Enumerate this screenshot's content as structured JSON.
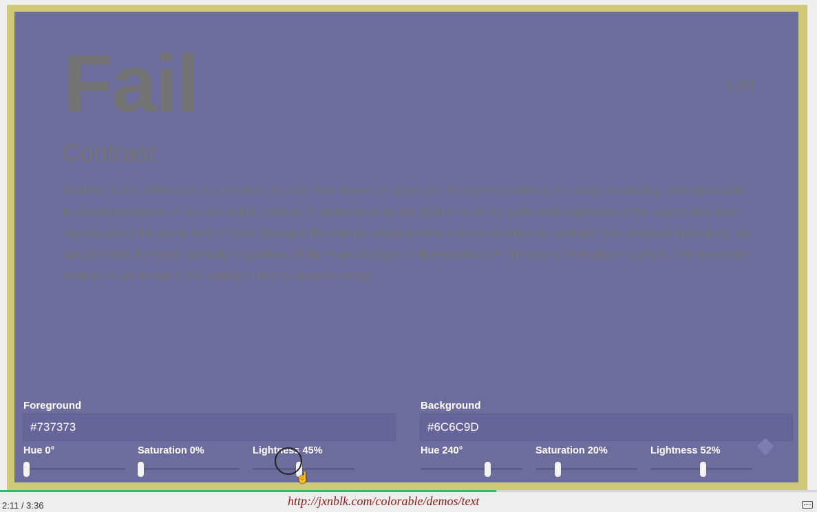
{
  "preview": {
    "status": "Fail",
    "ratio": "1.04",
    "heading": "Contrast",
    "body": "Contrast is the difference in luminance or color that makes an object (or its representation in an image or display) distinguishable. In visual perception of the real world, contrast is determined by the difference in the color and brightness of the object and other objects within the same field of view. Because the human visual system is more sensitive to contrast than absolute luminance, we can perceive the world similarly regardless of the huge changes in illumination over the day or from place to place. The maximum contrast of an image is the contrast ratio or dynamic range."
  },
  "foreground": {
    "label": "Foreground",
    "hex": "#737373",
    "hue_label": "Hue 0°",
    "saturation_label": "Saturation 0%",
    "lightness_label": "Lightness 45%",
    "hue": 0,
    "saturation": 0,
    "lightness": 45
  },
  "background": {
    "label": "Background",
    "hex": "#6C6C9D",
    "hue_label": "Hue 240°",
    "saturation_label": "Saturation 20%",
    "lightness_label": "Lightness 52%",
    "hue": 240,
    "saturation": 20,
    "lightness": 52
  },
  "player": {
    "time": "2:11  /  3:36",
    "progress": 0.607,
    "url": "http://jxnblk.com/colorable/demos/text"
  },
  "colors": {
    "foreground": "#737373",
    "background": "#6C6C9D",
    "frame": "#CFCA79",
    "progress": "#3CB371"
  },
  "icons": [
    "logo-icon",
    "closed-captions-icon",
    "hand-cursor-icon"
  ]
}
